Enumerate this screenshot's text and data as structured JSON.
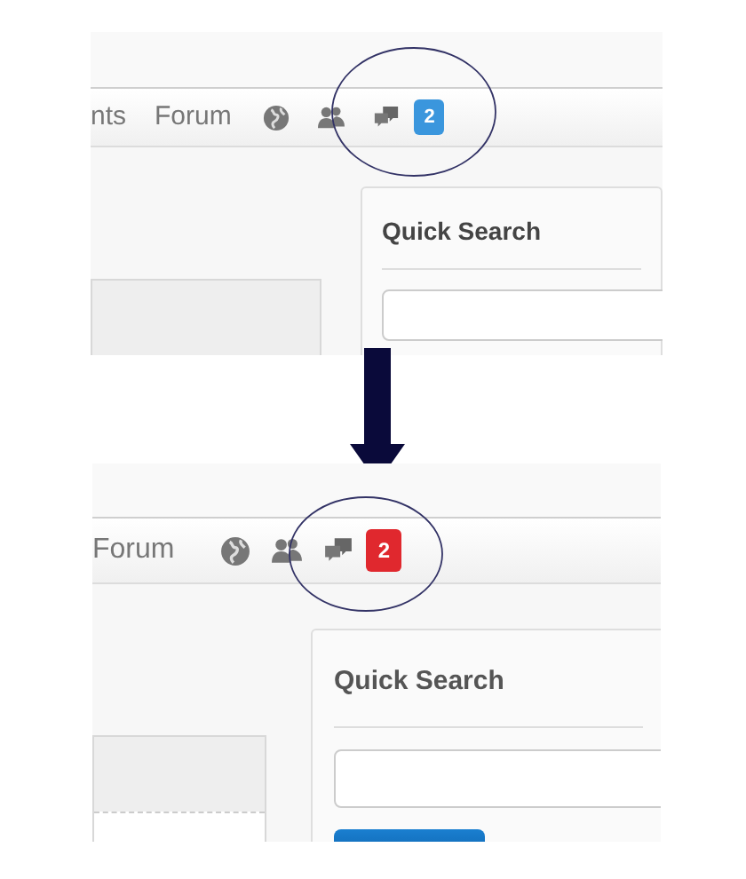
{
  "panels": [
    {
      "nav_items": [
        "nts",
        "Forum"
      ],
      "badge": {
        "text": "2",
        "color": "#3a96dd"
      },
      "sidebar_title": "Quick Search"
    },
    {
      "nav_items": [
        "Forum"
      ],
      "badge": {
        "text": "2",
        "color": "#e0282e"
      },
      "sidebar_title": "Quick Search",
      "search_button": true
    }
  ]
}
